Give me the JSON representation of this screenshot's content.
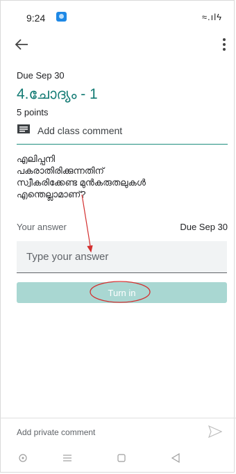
{
  "status_bar": {
    "time": "9:24",
    "indicators": "≈.ılϟ"
  },
  "toolbar": {
    "back_icon": "arrow-left-icon",
    "more_icon": "more-vertical-icon"
  },
  "assignment": {
    "due": "Due Sep 30",
    "title": "4.ചോദ്യം - 1",
    "points": "5 points",
    "class_comment_label": "Add class comment",
    "question_lines": [
      "എലിപ്പനി",
      "പകരാതിരിക്കുന്നതിന്",
      "സ്വീകരിക്കേണ്ട മുൻകരുതലുകൾ",
      "എന്തെല്ലാമാണ്?"
    ]
  },
  "answer": {
    "label": "Your answer",
    "due": "Due Sep 30",
    "placeholder": "Type your answer",
    "value": "",
    "turn_in_label": "Turn in"
  },
  "private_comment": {
    "label": "Add private comment",
    "send_icon": "send-icon"
  },
  "nav": {
    "icons": [
      "circle-nav-icon",
      "menu-nav-icon",
      "home-square-icon",
      "back-triangle-icon"
    ]
  },
  "colors": {
    "accent": "#137b74",
    "divider": "#1e8e7e",
    "turn_in_bg": "#a9d7d2",
    "annotation": "#d32f2f"
  }
}
